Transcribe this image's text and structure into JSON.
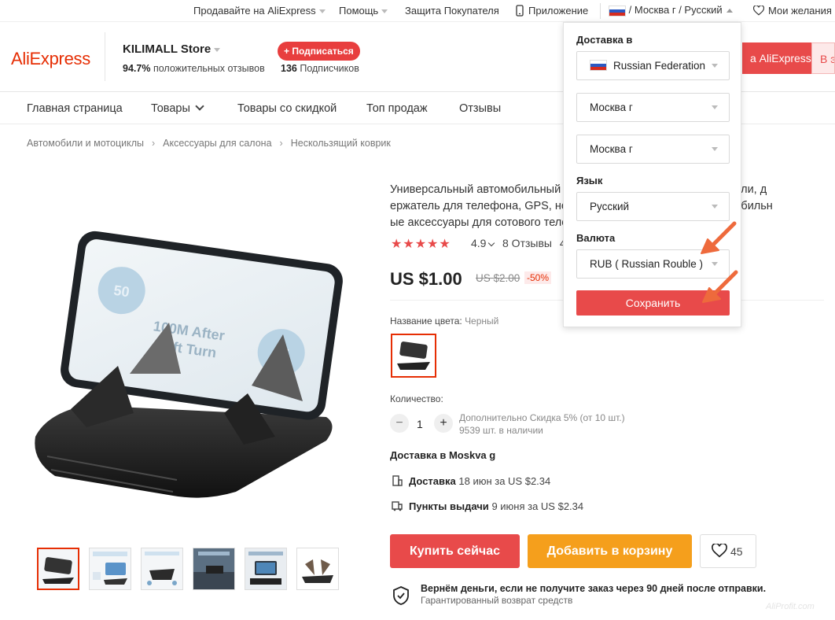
{
  "topbar": {
    "sell": "Продавайте на AliExpress",
    "help": "Помощь",
    "protection": "Защита Покупателя",
    "app": "Приложение",
    "locale": "/ Москва г / Русский",
    "wishlist": "Мои желания"
  },
  "header": {
    "logo": "AliExpress",
    "store_name": "KILIMALL Store",
    "rating_value": "94.7%",
    "rating_text": "положительных отзывов",
    "subscribe": "+ Подписаться",
    "subscribers_count": "136",
    "subscribers_text": "Подписчиков",
    "cta_red": "а AliExpress",
    "cta_pink": "В э"
  },
  "nav": {
    "items": [
      "Главная страница",
      "Товары",
      "Товары со скидкой",
      "Топ продаж",
      "Отзывы"
    ]
  },
  "breadcrumb": [
    "Автомобили и мотоциклы",
    "Аксессуары для салона",
    "Нескользящий коврик"
  ],
  "product": {
    "title": "Универсальный автомобильный коврик для приборной панели, держатель для телефона, GPS, нескользящий силиконовый автомобильные аксессуары для сотового телефона",
    "title_lines": [
      "Универсальный автомобильный                                        рной панели, д",
      "ержатель для телефона, GPS, нес                                         автомобильн",
      "ые аксессуары для сотового теле"
    ],
    "stars": "★★★★★",
    "rating": "4.9",
    "reviews": "8 Отзывы",
    "reviews_tail": "4",
    "price": "US $1.00",
    "old_price": "US $2.00",
    "discount": "-50%",
    "color_label": "Название цвета:",
    "color_value": "Черный",
    "qty_label": "Количество:",
    "qty_minus": "−",
    "qty_value": "1",
    "qty_plus": "+",
    "qty_note": "Дополнительно Скидка 5% (от 10 шт.)",
    "stock": "9539 шт. в наличии",
    "shipping_title": "Доставка в Moskva g",
    "delivery_label": "Доставка",
    "delivery_detail": "18 июн за US $2.34",
    "pickup_label": "Пункты выдачи",
    "pickup_detail": "9 июня за US $2.34",
    "buy_now": "Купить сейчас",
    "add_to_cart": "Добавить в корзину",
    "wish_count": "45",
    "guarantee_title": "Вернём деньги, если не получите заказ через 90 дней после отправки.",
    "guarantee_sub": "Гарантированный возврат средств",
    "watermark": "AliProfit.com"
  },
  "panel": {
    "ship_label": "Доставка в",
    "country": "Russian Federation",
    "region": "Москва г",
    "city": "Москва г",
    "lang_label": "Язык",
    "language": "Русский",
    "currency_label": "Валюта",
    "currency": "RUB ( Russian Rouble )",
    "save": "Сохранить"
  },
  "colors": {
    "accent_red": "#e84a4a",
    "brand_red": "#e62e04",
    "orange": "#f59f1c",
    "annotation": "#ee6a3c"
  }
}
